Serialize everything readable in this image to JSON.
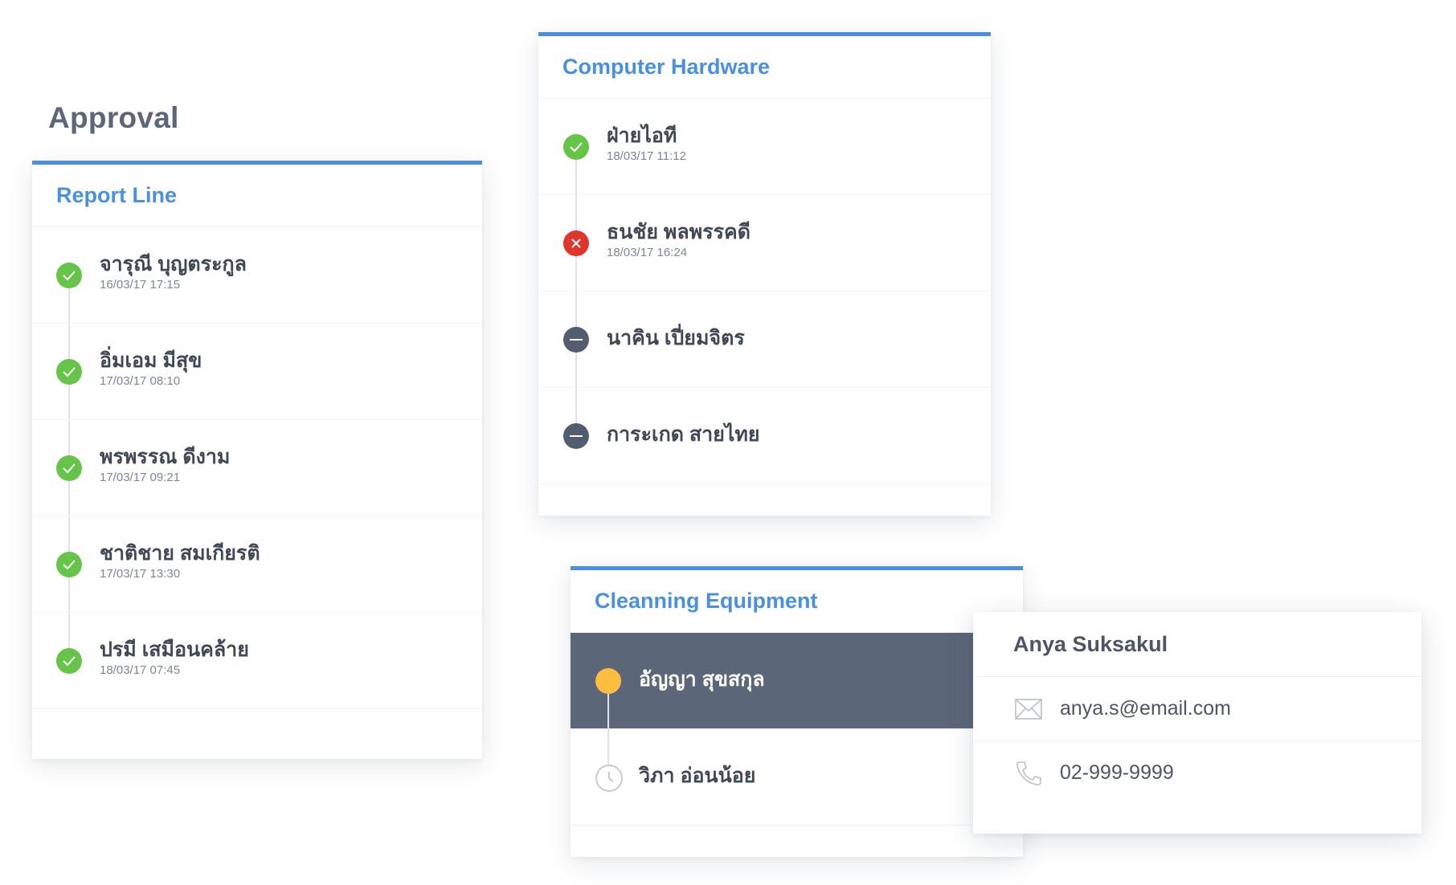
{
  "page": {
    "title": "Approval"
  },
  "report_line": {
    "title": "Report Line",
    "items": [
      {
        "name": "จารุณี บุญตระกูล",
        "timestamp": "16/03/17  17:15",
        "status": "approved",
        "status_icon": "check-circle-icon"
      },
      {
        "name": "อิ่มเอม มีสุข",
        "timestamp": "17/03/17  08:10",
        "status": "approved",
        "status_icon": "check-circle-icon"
      },
      {
        "name": "พรพรรณ ดีงาม",
        "timestamp": "17/03/17  09:21",
        "status": "approved",
        "status_icon": "check-circle-icon"
      },
      {
        "name": "ชาติชาย สมเกียรติ",
        "timestamp": "17/03/17  13:30",
        "status": "approved",
        "status_icon": "check-circle-icon"
      },
      {
        "name": "ปรมี เสมือนคล้าย",
        "timestamp": "18/03/17  07:45",
        "status": "approved",
        "status_icon": "check-circle-icon"
      }
    ]
  },
  "computer_hardware": {
    "title": "Computer Hardware",
    "items": [
      {
        "name": "ฝ่ายไอที",
        "timestamp": "18/03/17  11:12",
        "status": "approved",
        "status_icon": "check-circle-icon"
      },
      {
        "name": "ธนชัย พลพรรคดี",
        "timestamp": "18/03/17  16:24",
        "status": "rejected",
        "status_icon": "x-circle-icon"
      },
      {
        "name": "นาคิน เปี่ยมจิตร",
        "timestamp": "",
        "status": "skipped",
        "status_icon": "minus-circle-icon"
      },
      {
        "name": "การะเกด สายไทย",
        "timestamp": "",
        "status": "skipped",
        "status_icon": "minus-circle-icon"
      }
    ]
  },
  "cleaning_equipment": {
    "title": "Cleanning Equipment",
    "items": [
      {
        "name": "อัญญา สุขสกุล",
        "status": "current",
        "status_icon": "dot-circle-icon"
      },
      {
        "name": "วิภา อ่อนน้อย",
        "status": "pending",
        "status_icon": "clock-icon"
      }
    ]
  },
  "contact_popup": {
    "name": "Anya Suksakul",
    "email": "anya.s@email.com",
    "phone": "02-999-9999",
    "email_icon": "envelope-icon",
    "phone_icon": "phone-icon"
  },
  "colors": {
    "accent": "#4a90e2",
    "approved": "#66c548",
    "rejected": "#e0352b",
    "skipped": "#525e70",
    "current": "#fbbe3f",
    "active_row": "#5b6778"
  }
}
